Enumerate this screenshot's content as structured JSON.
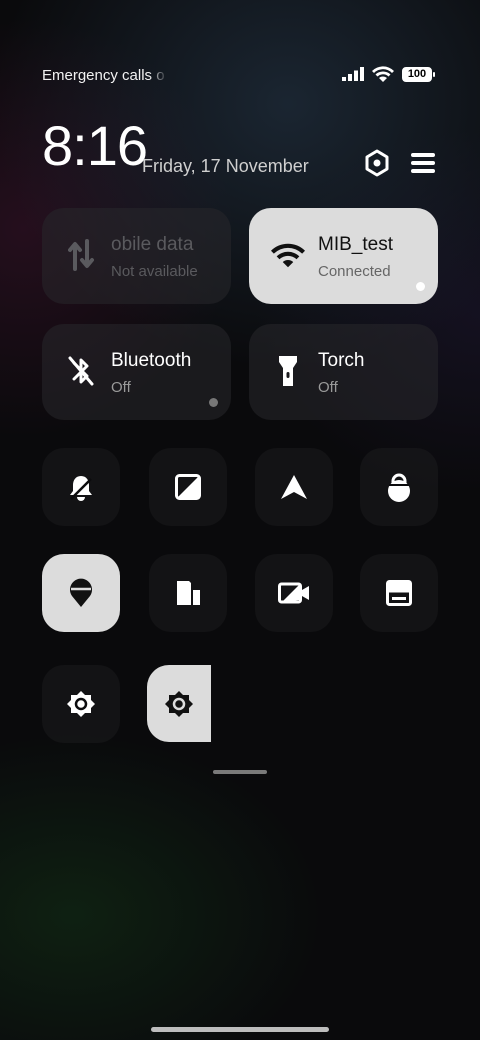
{
  "status_bar": {
    "carrier_text": "Emergency calls o",
    "battery_level": "100",
    "icons": [
      "signal-icon",
      "wifi-icon",
      "battery-icon"
    ]
  },
  "header": {
    "time": "8:16",
    "date": "Friday, 17 November",
    "settings_icon": "hexagon-settings-icon",
    "edit_icon": "menu-icon"
  },
  "tiles": [
    {
      "id": "mobile-data",
      "title": "obile data",
      "subtitle": "Not available",
      "icon": "mobile-data-icon",
      "state": "unavailable"
    },
    {
      "id": "wifi",
      "title": "MIB_test",
      "subtitle": "Connected",
      "icon": "wifi-icon",
      "state": "on"
    },
    {
      "id": "bluetooth",
      "title": "Bluetooth",
      "subtitle": "Off",
      "icon": "bluetooth-off-icon",
      "state": "off"
    },
    {
      "id": "torch",
      "title": "Torch",
      "subtitle": "Off",
      "icon": "torch-icon",
      "state": "off"
    }
  ],
  "toggles_row1": [
    "bell-icon",
    "auto-brightness-icon",
    "location-arrow-icon",
    "lock-rotation-icon"
  ],
  "toggles_row2": [
    "location-pin-icon",
    "dual-sim-icon",
    "screen-record-icon",
    "float-window-icon"
  ],
  "toggles_row3": [
    "brightness-icon",
    "brightness-icon-active"
  ],
  "colors": {
    "active_tile": "#dcdcdc",
    "inactive_tile": "#28282c",
    "accent_text": "#ffffff"
  }
}
